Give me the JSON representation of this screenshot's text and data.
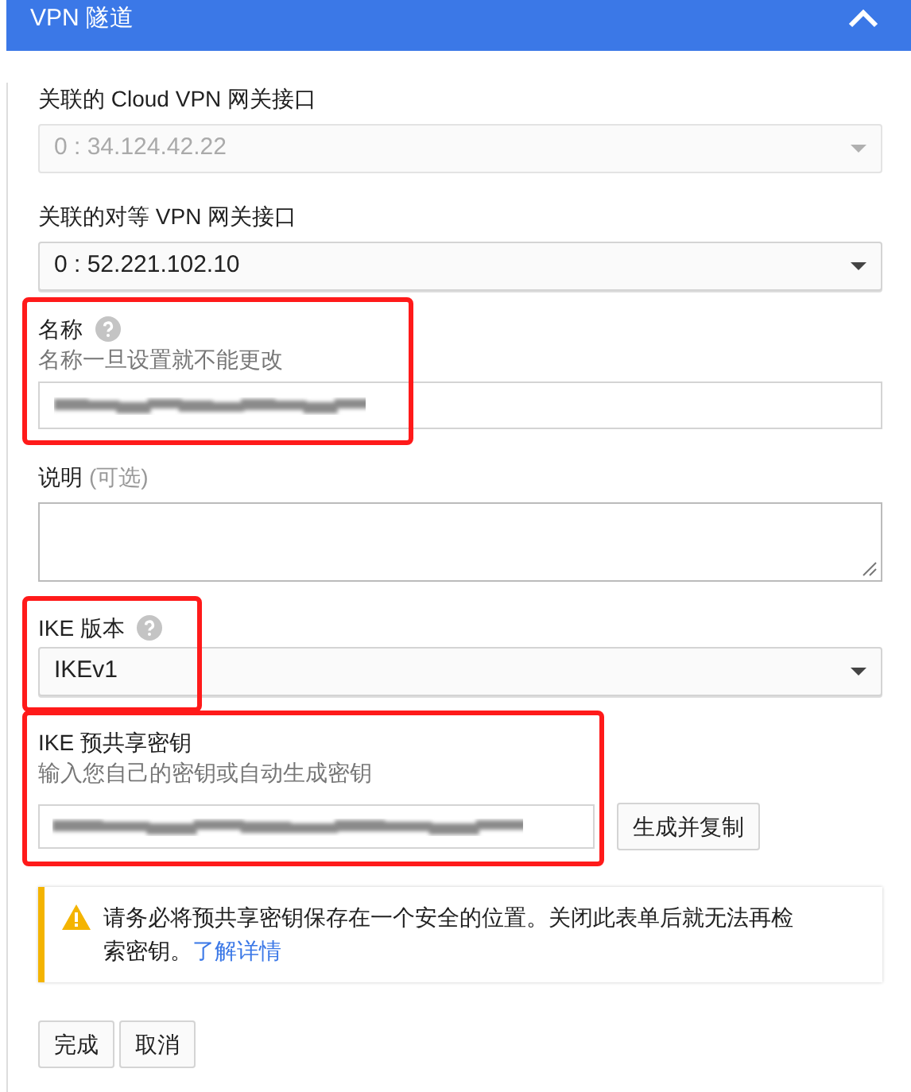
{
  "header": {
    "title": "VPN 隧道",
    "expanded": true
  },
  "fields": [
    {
      "kind": "select",
      "label": "关联的 Cloud VPN 网关接口",
      "value": "0 : 34.124.42.22",
      "disabled": true,
      "highlighted": false
    },
    {
      "kind": "select",
      "label": "关联的对等 VPN 网关接口",
      "value": "0 : 52.221.102.10",
      "disabled": false,
      "highlighted": false
    },
    {
      "kind": "text",
      "label": "名称",
      "help": true,
      "hint": "名称一旦设置就不能更改",
      "redacted": true,
      "highlighted": true
    },
    {
      "kind": "textarea",
      "label": "说明",
      "optional": "(可选)",
      "highlighted": false
    },
    {
      "kind": "select",
      "label": "IKE 版本",
      "help": true,
      "value": "IKEv1",
      "disabled": false,
      "highlighted": true
    },
    {
      "kind": "key",
      "label": "IKE 预共享密钥",
      "hint": "输入您自己的密钥或自动生成密钥",
      "redacted": true,
      "button": "生成并复制",
      "highlighted": true
    }
  ],
  "warning": {
    "text": "请务必将预共享密钥保存在一个安全的位置。关闭此表单后就无法再检索密钥。",
    "link": "了解详情"
  },
  "buttons": [
    "完成",
    "取消"
  ]
}
